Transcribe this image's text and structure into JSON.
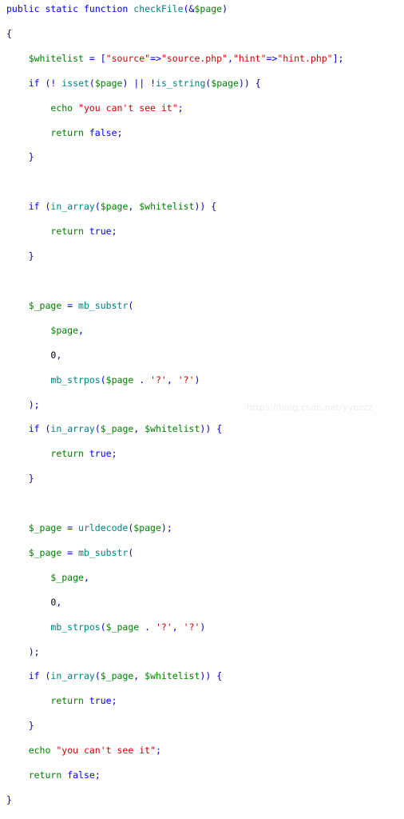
{
  "document": {
    "kind": "code-snippet",
    "language": "php",
    "background_color": "#ffffff",
    "colors": {
      "keyword": "#0000ff",
      "function": "#008080",
      "variable": "#008000",
      "string": "#cc0000",
      "operator": "#0000c0",
      "punctuation": "#0000c0",
      "plain": "#000000",
      "watermark": "#ededed"
    },
    "watermark": "https://blog.csdn.net/yybzzz",
    "lines": [
      {
        "indent": 0,
        "tokens": [
          {
            "text": "public",
            "type": "kw"
          },
          {
            "text": " ",
            "type": "plain"
          },
          {
            "text": "static",
            "type": "kw"
          },
          {
            "text": " ",
            "type": "plain"
          },
          {
            "text": "function",
            "type": "kw"
          },
          {
            "text": " ",
            "type": "plain"
          },
          {
            "text": "checkFile",
            "type": "fn"
          },
          {
            "text": "(",
            "type": "punc"
          },
          {
            "text": "&",
            "type": "op"
          },
          {
            "text": "$page",
            "type": "var"
          },
          {
            "text": ")",
            "type": "punc"
          }
        ]
      },
      {
        "indent": 0,
        "tokens": [
          {
            "text": "{",
            "type": "punc"
          }
        ]
      },
      {
        "indent": 1,
        "tokens": [
          {
            "text": "$whitelist",
            "type": "var"
          },
          {
            "text": " = ",
            "type": "op"
          },
          {
            "text": "[",
            "type": "punc"
          },
          {
            "text": "\"source\"",
            "type": "str"
          },
          {
            "text": "=>",
            "type": "op"
          },
          {
            "text": "\"source.php\"",
            "type": "str"
          },
          {
            "text": ",",
            "type": "punc"
          },
          {
            "text": "\"hint\"",
            "type": "str"
          },
          {
            "text": "=>",
            "type": "op"
          },
          {
            "text": "\"hint.php\"",
            "type": "str"
          },
          {
            "text": "];",
            "type": "punc"
          }
        ]
      },
      {
        "indent": 1,
        "tokens": [
          {
            "text": "if",
            "type": "kw"
          },
          {
            "text": " (",
            "type": "punc"
          },
          {
            "text": "!",
            "type": "op"
          },
          {
            "text": " ",
            "type": "plain"
          },
          {
            "text": "isset",
            "type": "fn"
          },
          {
            "text": "(",
            "type": "punc"
          },
          {
            "text": "$page",
            "type": "var"
          },
          {
            "text": ")",
            "type": "punc"
          },
          {
            "text": " || ",
            "type": "op"
          },
          {
            "text": "!",
            "type": "op"
          },
          {
            "text": "is_string",
            "type": "fn"
          },
          {
            "text": "(",
            "type": "punc"
          },
          {
            "text": "$page",
            "type": "var"
          },
          {
            "text": "))",
            "type": "punc"
          },
          {
            "text": " {",
            "type": "punc"
          }
        ]
      },
      {
        "indent": 2,
        "tokens": [
          {
            "text": "echo",
            "type": "echo"
          },
          {
            "text": " ",
            "type": "plain"
          },
          {
            "text": "\"you can't see it\"",
            "type": "str"
          },
          {
            "text": ";",
            "type": "punc"
          }
        ]
      },
      {
        "indent": 2,
        "tokens": [
          {
            "text": "return",
            "type": "echo"
          },
          {
            "text": " ",
            "type": "plain"
          },
          {
            "text": "false",
            "type": "const"
          },
          {
            "text": ";",
            "type": "punc"
          }
        ]
      },
      {
        "indent": 1,
        "tokens": [
          {
            "text": "}",
            "type": "punc"
          }
        ]
      },
      {
        "indent": 0,
        "tokens": []
      },
      {
        "indent": 1,
        "tokens": [
          {
            "text": "if",
            "type": "kw"
          },
          {
            "text": " (",
            "type": "punc"
          },
          {
            "text": "in_array",
            "type": "fn"
          },
          {
            "text": "(",
            "type": "punc"
          },
          {
            "text": "$page",
            "type": "var"
          },
          {
            "text": ", ",
            "type": "punc"
          },
          {
            "text": "$whitelist",
            "type": "var"
          },
          {
            "text": "))",
            "type": "punc"
          },
          {
            "text": " {",
            "type": "punc"
          }
        ]
      },
      {
        "indent": 2,
        "tokens": [
          {
            "text": "return",
            "type": "echo"
          },
          {
            "text": " ",
            "type": "plain"
          },
          {
            "text": "true",
            "type": "const"
          },
          {
            "text": ";",
            "type": "punc"
          }
        ]
      },
      {
        "indent": 1,
        "tokens": [
          {
            "text": "}",
            "type": "punc"
          }
        ]
      },
      {
        "indent": 0,
        "tokens": []
      },
      {
        "indent": 1,
        "tokens": [
          {
            "text": "$_page",
            "type": "var"
          },
          {
            "text": " = ",
            "type": "op"
          },
          {
            "text": "mb_substr",
            "type": "fn"
          },
          {
            "text": "(",
            "type": "punc"
          }
        ]
      },
      {
        "indent": 2,
        "tokens": [
          {
            "text": "$page",
            "type": "var"
          },
          {
            "text": ",",
            "type": "punc"
          }
        ]
      },
      {
        "indent": 2,
        "tokens": [
          {
            "text": "0",
            "type": "num"
          },
          {
            "text": ",",
            "type": "punc"
          }
        ]
      },
      {
        "indent": 2,
        "tokens": [
          {
            "text": "mb_strpos",
            "type": "fn"
          },
          {
            "text": "(",
            "type": "punc"
          },
          {
            "text": "$page",
            "type": "var"
          },
          {
            "text": " ",
            "type": "plain"
          },
          {
            "text": ".",
            "type": "op"
          },
          {
            "text": " ",
            "type": "plain"
          },
          {
            "text": "'?'",
            "type": "str"
          },
          {
            "text": ", ",
            "type": "punc"
          },
          {
            "text": "'?'",
            "type": "str"
          },
          {
            "text": ")",
            "type": "punc"
          }
        ]
      },
      {
        "indent": 1,
        "tokens": [
          {
            "text": ");",
            "type": "punc"
          }
        ]
      },
      {
        "indent": 1,
        "tokens": [
          {
            "text": "if",
            "type": "kw"
          },
          {
            "text": " (",
            "type": "punc"
          },
          {
            "text": "in_array",
            "type": "fn"
          },
          {
            "text": "(",
            "type": "punc"
          },
          {
            "text": "$_page",
            "type": "var"
          },
          {
            "text": ", ",
            "type": "punc"
          },
          {
            "text": "$whitelist",
            "type": "var"
          },
          {
            "text": "))",
            "type": "punc"
          },
          {
            "text": " {",
            "type": "punc"
          }
        ]
      },
      {
        "indent": 2,
        "tokens": [
          {
            "text": "return",
            "type": "echo"
          },
          {
            "text": " ",
            "type": "plain"
          },
          {
            "text": "true",
            "type": "const"
          },
          {
            "text": ";",
            "type": "punc"
          }
        ]
      },
      {
        "indent": 1,
        "tokens": [
          {
            "text": "}",
            "type": "punc"
          }
        ]
      },
      {
        "indent": 0,
        "tokens": []
      },
      {
        "indent": 1,
        "tokens": [
          {
            "text": "$_page",
            "type": "var"
          },
          {
            "text": " = ",
            "type": "op"
          },
          {
            "text": "urldecode",
            "type": "fn"
          },
          {
            "text": "(",
            "type": "punc"
          },
          {
            "text": "$page",
            "type": "var"
          },
          {
            "text": ");",
            "type": "punc"
          }
        ]
      },
      {
        "indent": 1,
        "tokens": [
          {
            "text": "$_page",
            "type": "var"
          },
          {
            "text": " = ",
            "type": "op"
          },
          {
            "text": "mb_substr",
            "type": "fn"
          },
          {
            "text": "(",
            "type": "punc"
          }
        ]
      },
      {
        "indent": 2,
        "tokens": [
          {
            "text": "$_page",
            "type": "var"
          },
          {
            "text": ",",
            "type": "punc"
          }
        ]
      },
      {
        "indent": 2,
        "tokens": [
          {
            "text": "0",
            "type": "num"
          },
          {
            "text": ",",
            "type": "punc"
          }
        ]
      },
      {
        "indent": 2,
        "tokens": [
          {
            "text": "mb_strpos",
            "type": "fn"
          },
          {
            "text": "(",
            "type": "punc"
          },
          {
            "text": "$_page",
            "type": "var"
          },
          {
            "text": " ",
            "type": "plain"
          },
          {
            "text": ".",
            "type": "op"
          },
          {
            "text": " ",
            "type": "plain"
          },
          {
            "text": "'?'",
            "type": "str"
          },
          {
            "text": ", ",
            "type": "punc"
          },
          {
            "text": "'?'",
            "type": "str"
          },
          {
            "text": ")",
            "type": "punc"
          }
        ]
      },
      {
        "indent": 1,
        "tokens": [
          {
            "text": ");",
            "type": "punc"
          }
        ]
      },
      {
        "indent": 1,
        "tokens": [
          {
            "text": "if",
            "type": "kw"
          },
          {
            "text": " (",
            "type": "punc"
          },
          {
            "text": "in_array",
            "type": "fn"
          },
          {
            "text": "(",
            "type": "punc"
          },
          {
            "text": "$_page",
            "type": "var"
          },
          {
            "text": ", ",
            "type": "punc"
          },
          {
            "text": "$whitelist",
            "type": "var"
          },
          {
            "text": "))",
            "type": "punc"
          },
          {
            "text": " {",
            "type": "punc"
          }
        ]
      },
      {
        "indent": 2,
        "tokens": [
          {
            "text": "return",
            "type": "echo"
          },
          {
            "text": " ",
            "type": "plain"
          },
          {
            "text": "true",
            "type": "const"
          },
          {
            "text": ";",
            "type": "punc"
          }
        ]
      },
      {
        "indent": 1,
        "tokens": [
          {
            "text": "}",
            "type": "punc"
          }
        ]
      },
      {
        "indent": 1,
        "tokens": [
          {
            "text": "echo",
            "type": "echo"
          },
          {
            "text": " ",
            "type": "plain"
          },
          {
            "text": "\"you can't see it\"",
            "type": "str"
          },
          {
            "text": ";",
            "type": "punc"
          }
        ]
      },
      {
        "indent": 1,
        "tokens": [
          {
            "text": "return",
            "type": "echo"
          },
          {
            "text": " ",
            "type": "plain"
          },
          {
            "text": "false",
            "type": "const"
          },
          {
            "text": ";",
            "type": "punc"
          }
        ]
      },
      {
        "indent": 0,
        "tokens": [
          {
            "text": "}",
            "type": "punc"
          }
        ]
      }
    ]
  }
}
